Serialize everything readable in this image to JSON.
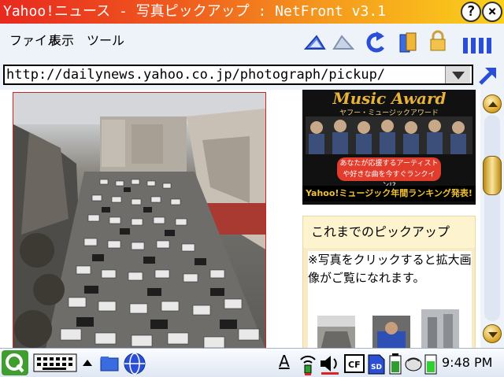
{
  "window": {
    "title": "Yahoo!ニュース - 写真ピックアップ : NetFront v3.1",
    "help_label": "?",
    "close_label": "×"
  },
  "menu": {
    "items": [
      "ファイル",
      "表示",
      "ツール"
    ]
  },
  "toolbar": {
    "icons": [
      "back-icon",
      "forward-icon",
      "reload-icon",
      "bookmarks-icon",
      "lock-icon",
      "view-mode-icon"
    ]
  },
  "address": {
    "url": "http://dailynews.yahoo.co.jp/photograph/pickup/"
  },
  "banner": {
    "title": "Music Award",
    "subtitle": "ヤフー・ミュージックアワード",
    "message": "あなたが応援するアーティストや好きな曲を今すぐランクイン!?",
    "footer": "Yahoo!ミュージック年間ランキング発表!"
  },
  "pickup": {
    "heading": "これまでのピックアップ",
    "description": "※写真をクリックすると拡大画像がご覧になれます。"
  },
  "taskbar": {
    "time": "9:48 PM",
    "font_indicator": "A"
  },
  "colors": {
    "accent": "#e8291f",
    "scroll": "#d6a11c",
    "link_blue": "#2a4fd6"
  }
}
